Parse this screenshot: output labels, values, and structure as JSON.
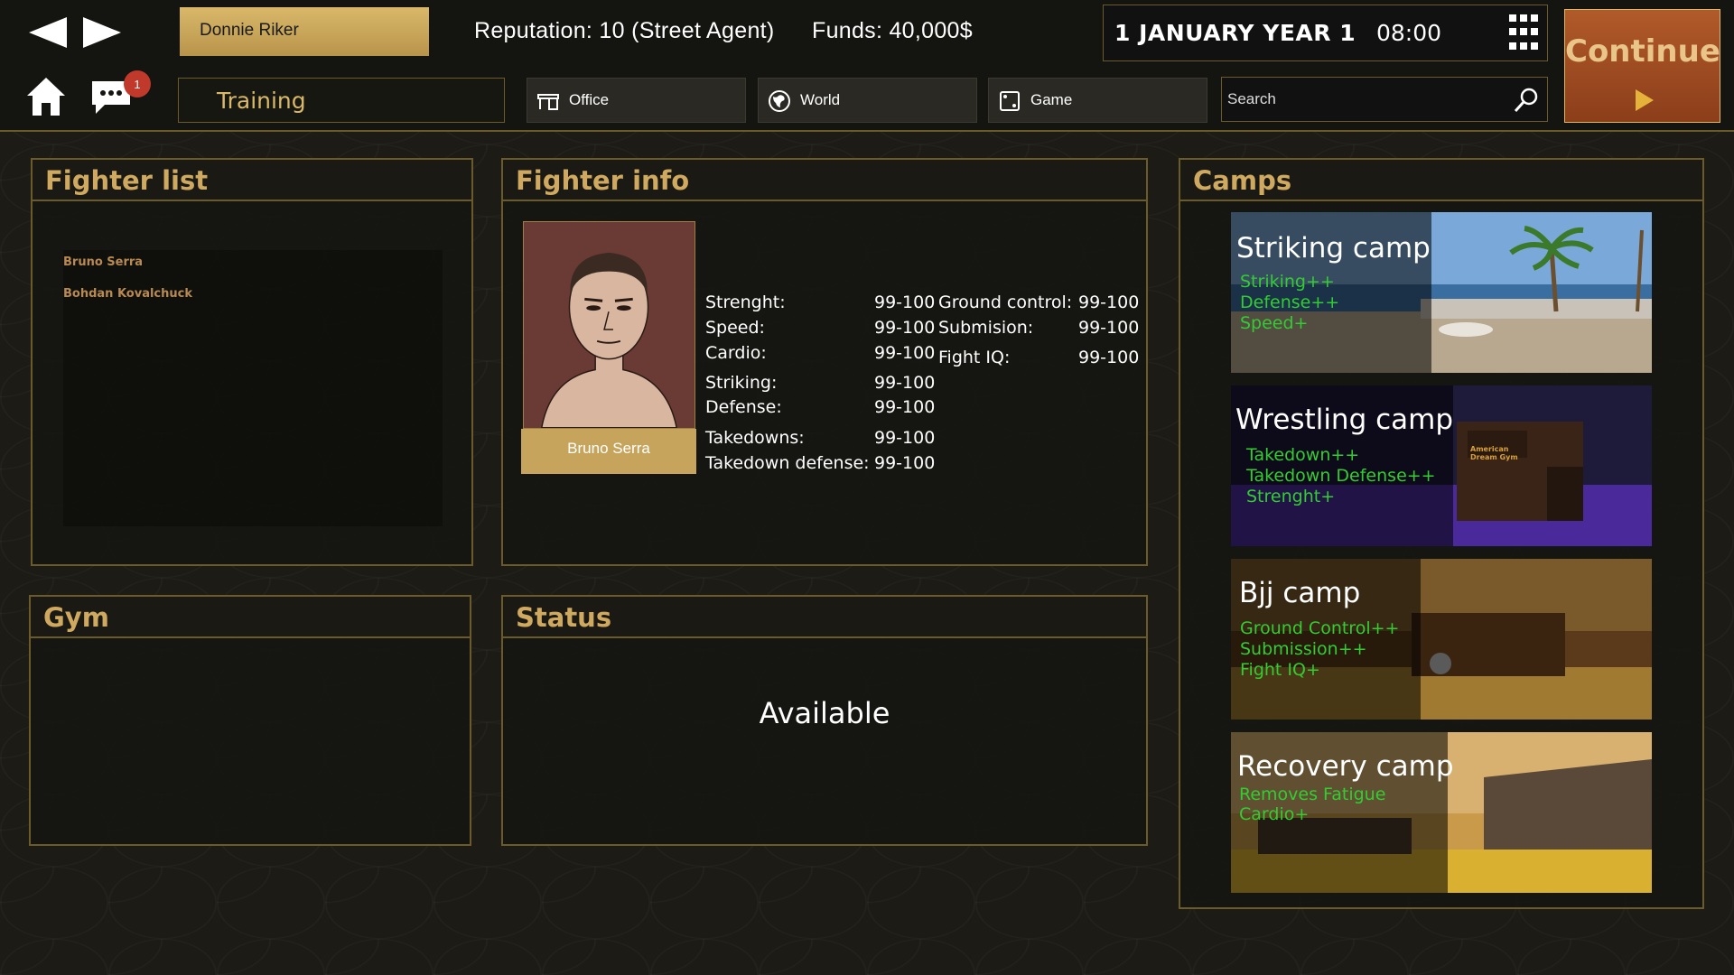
{
  "header": {
    "user_name": "Donnie Riker",
    "reputation": "Reputation: 10 (Street Agent)",
    "funds": "Funds: 40,000$",
    "date": "1 JANUARY YEAR 1",
    "time": "08:00",
    "continue_label": "Continue",
    "notification_count": "1"
  },
  "tabs": {
    "training": "Training",
    "office": "Office",
    "world": "World",
    "game": "Game"
  },
  "search": {
    "placeholder": "Search"
  },
  "panels": {
    "fighter_list_title": "Fighter list",
    "fighter_info_title": "Fighter info",
    "camps_title": "Camps",
    "gym_title": "Gym",
    "status_title": "Status"
  },
  "fighters": [
    "Bruno Serra",
    "Bohdan Kovalchuck"
  ],
  "fighter_info": {
    "name": "Bruno Serra",
    "stats_left": [
      {
        "label": "Strenght:",
        "value": "99-100"
      },
      {
        "label": "Speed:",
        "value": "99-100"
      },
      {
        "label": "Cardio:",
        "value": "99-100"
      },
      {
        "label": "Striking:",
        "value": "99-100"
      },
      {
        "label": "Defense:",
        "value": "99-100"
      },
      {
        "label": "Takedowns:",
        "value": "99-100"
      },
      {
        "label": "Takedown defense:",
        "value": "99-100"
      }
    ],
    "stats_right": [
      {
        "label": "Ground control:",
        "value": "99-100"
      },
      {
        "label": "Submision:",
        "value": "99-100"
      },
      {
        "label": "Fight IQ:",
        "value": "99-100"
      }
    ]
  },
  "status": {
    "value": "Available"
  },
  "camps": [
    {
      "title": "Striking camp",
      "bonuses": [
        "Striking++",
        "Defense++",
        "Speed+"
      ]
    },
    {
      "title": "Wrestling camp",
      "bonuses": [
        "Takedown++",
        "Takedown Defense++",
        "Strenght+"
      ],
      "sign": "American Dream Gym"
    },
    {
      "title": "Bjj camp",
      "bonuses": [
        "Ground Control++",
        "Submission++",
        "Fight IQ+"
      ]
    },
    {
      "title": "Recovery camp",
      "bonuses": [
        "Removes Fatigue",
        "Cardio+"
      ]
    }
  ],
  "colors": {
    "accent_gold": "#cfa960",
    "continue_bg": "#a14c22",
    "bonus_green": "#33cc33"
  }
}
